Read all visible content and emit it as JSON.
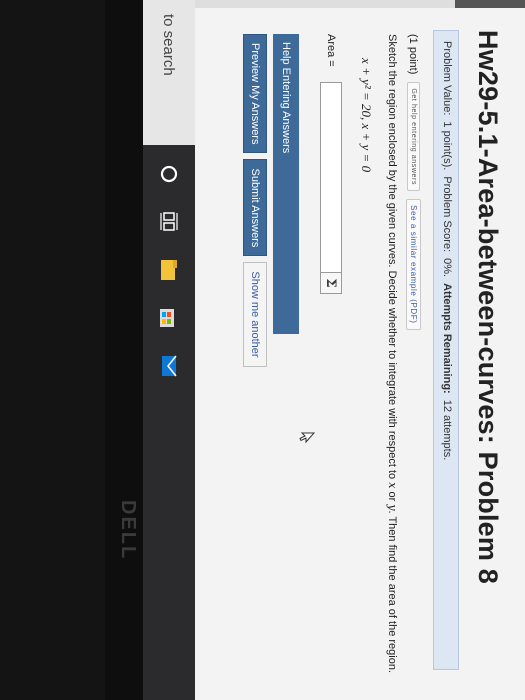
{
  "problem": {
    "title": "Hw29-5.1-Area-between-curves: Problem 8",
    "info": {
      "value_label": "Problem Value:",
      "value_text": "1 point(s).",
      "score_label": "Problem Score:",
      "score_text": "0%.",
      "attempts_label": "Attempts Remaining:",
      "attempts_text": "12 attempts."
    },
    "points": "(1 point)",
    "help_link_small": "Get help entering answers",
    "similar_example": "See a similar example (PDF)",
    "instruction_start": "Sketch the region enclosed by the given curves. Decide whether to integrate with respect to",
    "var_x": "x",
    "or_text": "or",
    "var_y": "y",
    "instruction_end": ". Then find the area of the region.",
    "equation": "x + y² = 20,   x + y = 0",
    "area_label": "Area =",
    "area_value": ""
  },
  "buttons": {
    "help": "Help Entering Answers",
    "preview": "Preview My Answers",
    "submit": "Submit Answers",
    "show_another": "Show me another"
  },
  "taskbar": {
    "search_text": "to search",
    "icons": [
      "cortana-icon",
      "task-view-icon",
      "file-explorer-icon",
      "store-icon",
      "mail-icon"
    ]
  },
  "brand": "DELL",
  "colors": {
    "accent": "#3d6a98",
    "info_bar": "#dde6f3",
    "taskbar": "#2b2b2d"
  }
}
